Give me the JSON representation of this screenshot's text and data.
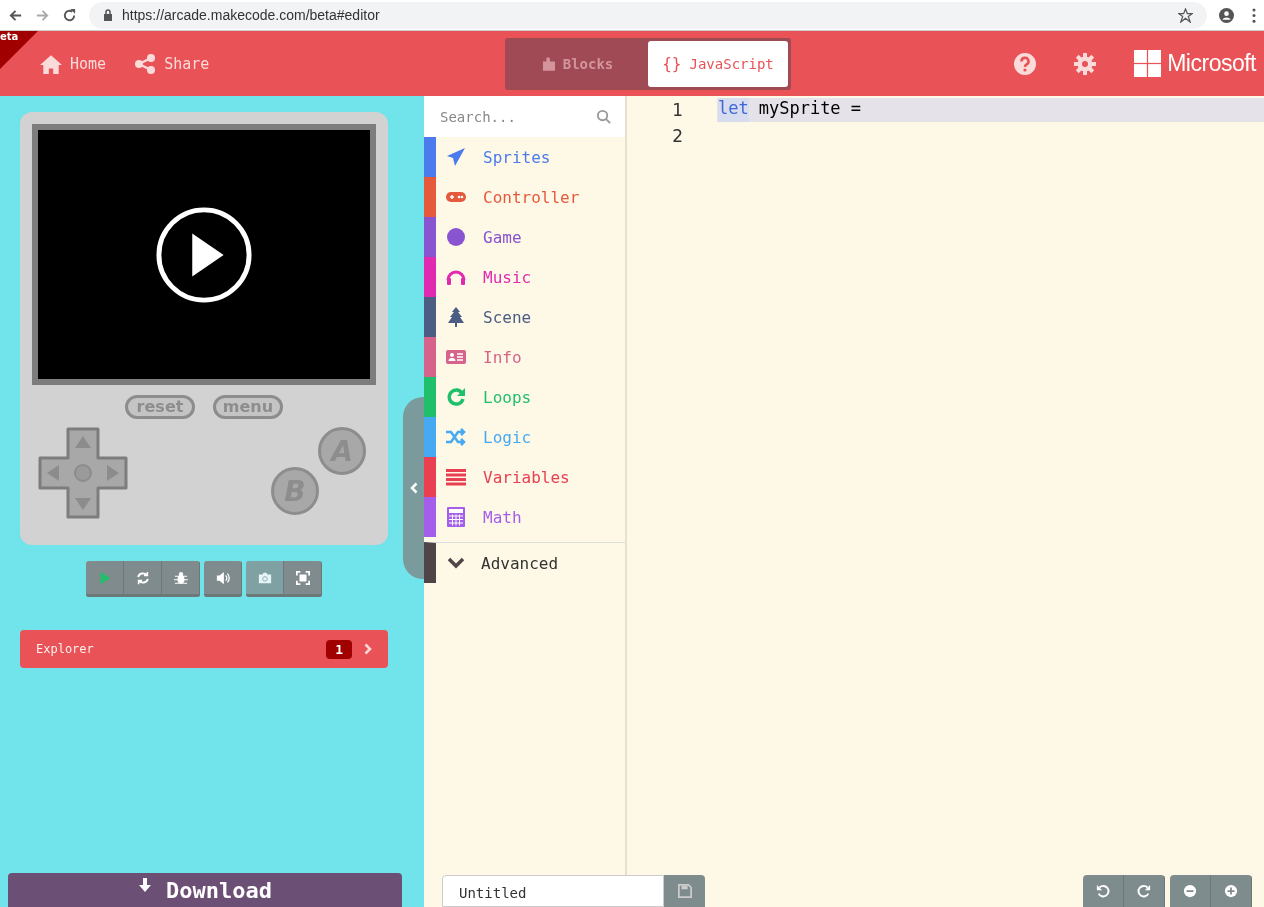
{
  "browser": {
    "url": "https://arcade.makecode.com/beta#editor"
  },
  "header": {
    "beta_badge": "eta",
    "home": "Home",
    "share": "Share",
    "tabs": [
      {
        "label": "Blocks",
        "selected": false
      },
      {
        "label": "JavaScript",
        "glyph": "{}",
        "selected": true
      }
    ],
    "brand": "Microsoft"
  },
  "simulator": {
    "reset": "reset",
    "menu": "menu",
    "button_a": "A",
    "button_b": "B",
    "toolbar": [
      {
        "kind": "play"
      },
      {
        "kind": "restart"
      },
      {
        "kind": "debug"
      },
      {
        "kind": "sound"
      },
      {
        "kind": "screenshot"
      },
      {
        "kind": "fullscreen"
      }
    ],
    "explorer": {
      "label": "Explorer",
      "count": "1"
    },
    "download": "Download"
  },
  "toolbox": {
    "search": {
      "placeholder": "Search..."
    },
    "categories": [
      {
        "name": "Sprites",
        "kind": "sprites",
        "color": "#4b7bec"
      },
      {
        "name": "Controller",
        "kind": "controller",
        "color": "#e55a3c"
      },
      {
        "name": "Game",
        "kind": "game",
        "color": "#8854d0"
      },
      {
        "name": "Music",
        "kind": "music",
        "color": "#e02ab0"
      },
      {
        "name": "Scene",
        "kind": "scene",
        "color": "#4b5d83"
      },
      {
        "name": "Info",
        "kind": "info",
        "color": "#d6638a"
      },
      {
        "name": "Loops",
        "kind": "loops",
        "color": "#20bf6b"
      },
      {
        "name": "Logic",
        "kind": "logic",
        "color": "#45aaf2"
      },
      {
        "name": "Variables",
        "kind": "variables",
        "color": "#e84050"
      },
      {
        "name": "Math",
        "kind": "math",
        "color": "#a55eea"
      }
    ],
    "advanced": "Advanced"
  },
  "editor": {
    "lines": [
      {
        "number": "1",
        "keyword": "let",
        "text": "mySprite =",
        "selected": true
      },
      {
        "number": "2",
        "selected": false
      }
    ]
  },
  "footer": {
    "project_name": "Untitled"
  }
}
